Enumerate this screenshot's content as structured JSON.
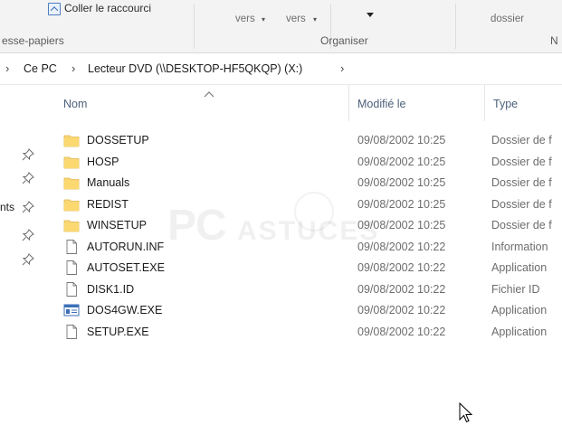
{
  "ribbon": {
    "paste_shortcut": "Coller le raccourci",
    "vers1": "vers",
    "vers2": "vers",
    "dossier": "dossier",
    "clipboard_label": "esse-papiers",
    "organize_label": "Organiser",
    "new_label_partial": "N"
  },
  "address": {
    "crumbs": [
      "Ce PC",
      "Lecteur DVD (\\\\DESKTOP-HF5QKQP) (X:)"
    ]
  },
  "nav": {
    "partial_label": "nts"
  },
  "columns": {
    "name": "Nom",
    "modified": "Modifié le",
    "type": "Type"
  },
  "files": [
    {
      "name": "DOSSETUP",
      "modified": "09/08/2002 10:25",
      "type": "Dossier de f",
      "icon": "folder-icon"
    },
    {
      "name": "HOSP",
      "modified": "09/08/2002 10:25",
      "type": "Dossier de f",
      "icon": "folder-icon"
    },
    {
      "name": "Manuals",
      "modified": "09/08/2002 10:25",
      "type": "Dossier de f",
      "icon": "folder-icon"
    },
    {
      "name": "REDIST",
      "modified": "09/08/2002 10:25",
      "type": "Dossier de f",
      "icon": "folder-icon"
    },
    {
      "name": "WINSETUP",
      "modified": "09/08/2002 10:25",
      "type": "Dossier de f",
      "icon": "folder-icon"
    },
    {
      "name": "AUTORUN.INF",
      "modified": "09/08/2002 10:22",
      "type": "Information",
      "icon": "file-icon"
    },
    {
      "name": "AUTOSET.EXE",
      "modified": "09/08/2002 10:22",
      "type": "Application",
      "icon": "file-icon"
    },
    {
      "name": "DISK1.ID",
      "modified": "09/08/2002 10:22",
      "type": "Fichier ID",
      "icon": "file-icon"
    },
    {
      "name": "DOS4GW.EXE",
      "modified": "09/08/2002 10:22",
      "type": "Application",
      "icon": "exe-window-icon"
    },
    {
      "name": "SETUP.EXE",
      "modified": "09/08/2002 10:22",
      "type": "Application",
      "icon": "file-icon"
    }
  ],
  "colors": {
    "folder": "#f8d775",
    "header_text": "#4c607a",
    "secondary_text": "#6d6d6d"
  }
}
